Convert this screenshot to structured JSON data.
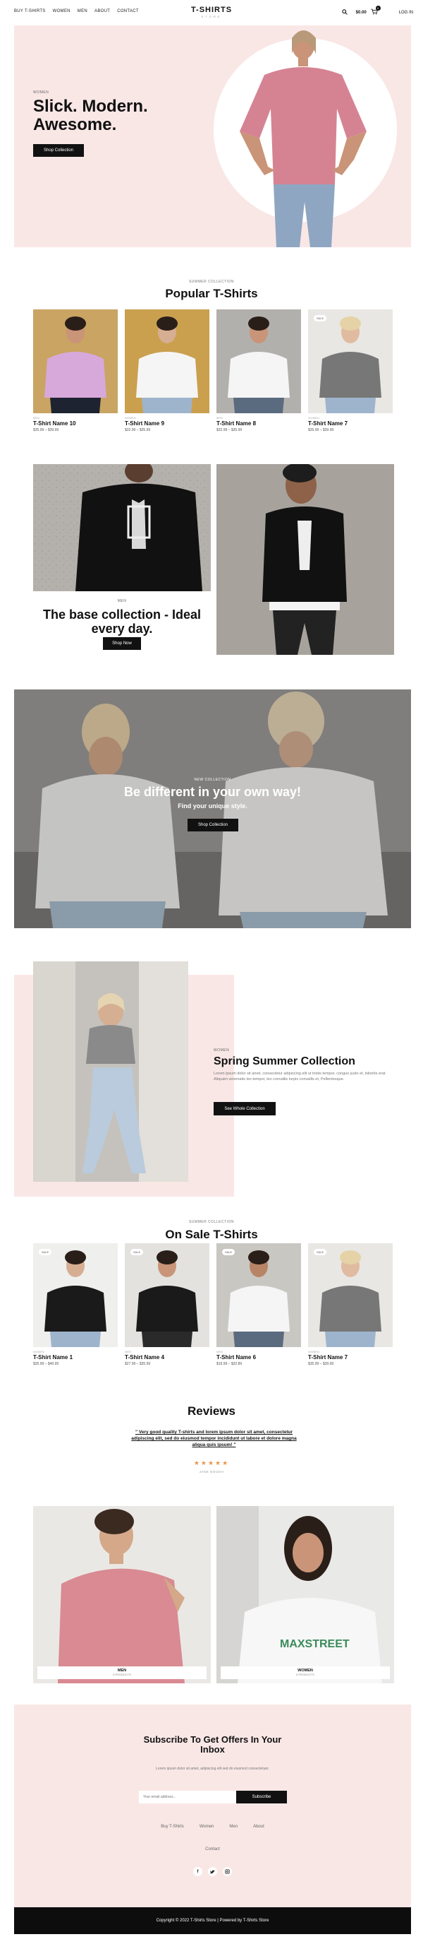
{
  "header": {
    "nav": [
      "BUY T-SHIRTS",
      "WOMEN",
      "MEN",
      "ABOUT",
      "CONTACT"
    ],
    "logo_title": "T-SHIRTS",
    "logo_sub": "STORE",
    "cart_amount": "$0.00",
    "cart_count": "0",
    "login": "LOG IN"
  },
  "hero": {
    "eyebrow": "WOMEN",
    "title": "Slick. Modern. Awesome.",
    "button": "Shop Collection"
  },
  "popular": {
    "eyebrow": "SUMMER COLLECTION",
    "title": "Popular T-Shirts",
    "products": [
      {
        "category": "MEN",
        "name": "T-Shirt Name 10",
        "price": "$35.99 – $39.99",
        "badge": ""
      },
      {
        "category": "WOMEN",
        "name": "T-Shirt Name 9",
        "price": "$32.99 – $35.99",
        "badge": ""
      },
      {
        "category": "MEN",
        "name": "T-Shirt Name 8",
        "price": "$32.99 – $35.99",
        "badge": ""
      },
      {
        "category": "WOMEN",
        "name": "T-Shirt Name 7",
        "price": "$35.99 – $39.99",
        "badge": "SALE"
      }
    ]
  },
  "base": {
    "eyebrow": "MEN",
    "title": "The base collection - Ideal every day.",
    "button": "Shop Now"
  },
  "banner": {
    "eyebrow": "NEW COLLECTION",
    "title": "Be different in your own way!",
    "subtitle": "Find your unique style.",
    "button": "Shop Collection"
  },
  "spring": {
    "eyebrow": "WOMEN",
    "title": "Spring Summer Collection",
    "body": "Lorem ipsum dolor sit amet, consectetur adipiscing elit ut tristis tempor, congue justo et, lobortis erat. Aliquam venenatis leo tempor, leo convallis turpis convallis et, Pellentesque.",
    "button": "See Whole Collection"
  },
  "sale": {
    "eyebrow": "SUMMER COLLECTION",
    "title": "On Sale T-Shirts",
    "products": [
      {
        "category": "WOMEN",
        "name": "T-Shirt Name 1",
        "price": "$35.99 – $49.99",
        "badge": "SALE"
      },
      {
        "category": "MEN",
        "name": "T-Shirt Name 4",
        "price": "$27.99 – $35.99",
        "badge": "SALE"
      },
      {
        "category": "MEN",
        "name": "T-Shirt Name 6",
        "price": "$19.99 – $32.89",
        "badge": "SALE"
      },
      {
        "category": "WOMEN",
        "name": "T-Shirt Name 7",
        "price": "$35.99 – $39.99",
        "badge": "SALE"
      }
    ]
  },
  "reviews": {
    "title": "Reviews",
    "quote": "\" Very good quality T-shirts and lorem ipsum dolor sit amet, consectetur adipiscing elit, sed do eiusmod tempor incididunt ut labore et dolore magna aliqua quis ipsum! \"",
    "stars": "★★★★★",
    "author": "JANE DOUGH"
  },
  "categories": [
    {
      "label": "MEN",
      "count": "5 PRODUCTS"
    },
    {
      "label": "WOMEN",
      "count": "5 PRODUCTS"
    }
  ],
  "newsletter": {
    "title": "Subscribe To Get Offers In Your Inbox",
    "body": "Lorem ipsum dolor sit amet, adipiscing elit sed do eiusmod consectetuer.",
    "placeholder": "Your email address...",
    "button": "Subscribe"
  },
  "footer": {
    "links": [
      "Buy T-Shirts",
      "Women",
      "Men",
      "About"
    ],
    "contact": "Contact",
    "social": [
      "facebook-icon",
      "twitter-icon",
      "instagram-icon"
    ],
    "copyright": "Copyright © 2022 T-Shirts Store | Powered by T-Shirts Store"
  },
  "colors": {
    "pink": "#f9e7e6",
    "black": "#111111",
    "star": "#e8974b"
  }
}
